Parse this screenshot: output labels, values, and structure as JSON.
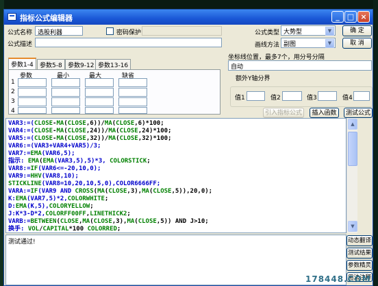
{
  "window": {
    "title": "指标公式编辑器"
  },
  "form": {
    "name_label": "公式名称",
    "name_value": "选股利器",
    "password_label": "密码保护",
    "password_checked": false,
    "desc_label": "公式描述",
    "desc_value": "",
    "type_label": "公式类型",
    "type_value": "大势型",
    "draw_label": "画线方法",
    "draw_value": "副图",
    "ok_label": "确  定",
    "cancel_label": "取  消"
  },
  "tabs": [
    {
      "label": "参数1-4",
      "active": true
    },
    {
      "label": "参数5-8",
      "active": false
    },
    {
      "label": "参数9-12",
      "active": false
    },
    {
      "label": "参数13-16",
      "active": false
    }
  ],
  "param_table": {
    "headers": [
      "参数",
      "最小",
      "最大",
      "缺省"
    ],
    "rows": [
      "1",
      "2",
      "3",
      "4"
    ]
  },
  "axis": {
    "label": "坐标线位置，最多7个，用分号分隔",
    "value": "自动"
  },
  "extra_y": {
    "legend": "额外Y轴分界",
    "values": [
      "值1",
      "值2",
      "值3",
      "值4"
    ]
  },
  "buttons": {
    "import": "引入指标公式",
    "insert_func": "插入函数",
    "test": "测试公式"
  },
  "code": [
    [
      [
        "VAR3:=(",
        "b"
      ],
      [
        "CLOSE",
        "g"
      ],
      [
        "-",
        "k"
      ],
      [
        "MA",
        "g"
      ],
      [
        "(",
        "k"
      ],
      [
        "CLOSE",
        "g"
      ],
      [
        ",6))/",
        "k"
      ],
      [
        "MA",
        "g"
      ],
      [
        "(",
        "k"
      ],
      [
        "CLOSE",
        "g"
      ],
      [
        ",6)*100;",
        "k"
      ]
    ],
    [
      [
        "VAR4:=(",
        "b"
      ],
      [
        "CLOSE",
        "g"
      ],
      [
        "-",
        "k"
      ],
      [
        "MA",
        "g"
      ],
      [
        "(",
        "k"
      ],
      [
        "CLOSE",
        "g"
      ],
      [
        ",24))/",
        "k"
      ],
      [
        "MA",
        "g"
      ],
      [
        "(",
        "k"
      ],
      [
        "CLOSE",
        "g"
      ],
      [
        ",24)*100;",
        "k"
      ]
    ],
    [
      [
        "VAR5:=(",
        "b"
      ],
      [
        "CLOSE",
        "g"
      ],
      [
        "-",
        "k"
      ],
      [
        "MA",
        "g"
      ],
      [
        "(",
        "k"
      ],
      [
        "CLOSE",
        "g"
      ],
      [
        ",32))/",
        "k"
      ],
      [
        "MA",
        "g"
      ],
      [
        "(",
        "k"
      ],
      [
        "CLOSE",
        "g"
      ],
      [
        ",32)*100;",
        "k"
      ]
    ],
    [
      [
        "VAR6:=(VAR3+VAR4+VAR5)/3;",
        "b"
      ]
    ],
    [
      [
        "VAR7:=",
        "b"
      ],
      [
        "EMA",
        "g"
      ],
      [
        "(VAR6,5);",
        "b"
      ]
    ],
    [
      [
        "指示: ",
        "b"
      ],
      [
        "EMA",
        "g"
      ],
      [
        "(",
        "k"
      ],
      [
        "EMA",
        "g"
      ],
      [
        "(VAR3,5),5)*3, ",
        "b"
      ],
      [
        "COLORSTICK",
        "g"
      ],
      [
        ";",
        "k"
      ]
    ],
    [
      [
        "VAR8:=",
        "b"
      ],
      [
        "IF",
        "g"
      ],
      [
        "(VAR6<=-20,10,0);",
        "b"
      ]
    ],
    [
      [
        "VAR9:=",
        "b"
      ],
      [
        "HHV",
        "g"
      ],
      [
        "(VAR8,10);",
        "b"
      ]
    ],
    [
      [
        "STICKLINE",
        "g"
      ],
      [
        "(VAR8=10,20,10,5,0),COLOR6666FF;",
        "b"
      ]
    ],
    [
      [
        "VARA:=",
        "b"
      ],
      [
        "IF",
        "g"
      ],
      [
        "(VAR9 AND ",
        "b"
      ],
      [
        "CROSS",
        "g"
      ],
      [
        "(",
        "k"
      ],
      [
        "MA",
        "g"
      ],
      [
        "(",
        "k"
      ],
      [
        "CLOSE",
        "g"
      ],
      [
        ",3),",
        "k"
      ],
      [
        "MA",
        "g"
      ],
      [
        "(",
        "k"
      ],
      [
        "CLOSE",
        "g"
      ],
      [
        ",5)),20,0);",
        "k"
      ]
    ],
    [
      [
        "K:",
        "b"
      ],
      [
        "EMA",
        "g"
      ],
      [
        "(VAR7,5)*2,",
        "b"
      ],
      [
        "COLORWHITE",
        "g"
      ],
      [
        ";",
        "k"
      ]
    ],
    [
      [
        "D:",
        "b"
      ],
      [
        "EMA",
        "g"
      ],
      [
        "(K,5),",
        "b"
      ],
      [
        "COLORYELLOW",
        "g"
      ],
      [
        ";",
        "k"
      ]
    ],
    [
      [
        "J:K*3-D*2,",
        "b"
      ],
      [
        "COLORFF00FF",
        "g"
      ],
      [
        ",",
        "k"
      ],
      [
        "LINETHICK2",
        "g"
      ],
      [
        ";",
        "k"
      ]
    ],
    [
      [
        "VARB:=",
        "b"
      ],
      [
        "BETWEEN",
        "g"
      ],
      [
        "(",
        "k"
      ],
      [
        "CLOSE",
        "g"
      ],
      [
        ",",
        "k"
      ],
      [
        "MA",
        "g"
      ],
      [
        "(",
        "k"
      ],
      [
        "CLOSE",
        "g"
      ],
      [
        ",3),",
        "k"
      ],
      [
        "MA",
        "g"
      ],
      [
        "(",
        "k"
      ],
      [
        "CLOSE",
        "g"
      ],
      [
        ",5)) AND J>10;",
        "k"
      ]
    ],
    [
      [
        "换手: ",
        "b"
      ],
      [
        "VOL",
        "g"
      ],
      [
        "/",
        "k"
      ],
      [
        "CAPITAL",
        "g"
      ],
      [
        "*100 ",
        "k"
      ],
      [
        "COLORRED",
        "g"
      ],
      [
        ";",
        "k"
      ]
    ]
  ],
  "output": {
    "text": "测试通过!"
  },
  "side_buttons": [
    "动态翻译",
    "测试结果",
    "参数精灵",
    "用法注释"
  ],
  "watermark": "178448.COM",
  "colors": {
    "title_blue": "#1a57d6",
    "code_green": "#008000",
    "code_blue": "#0000cc"
  }
}
